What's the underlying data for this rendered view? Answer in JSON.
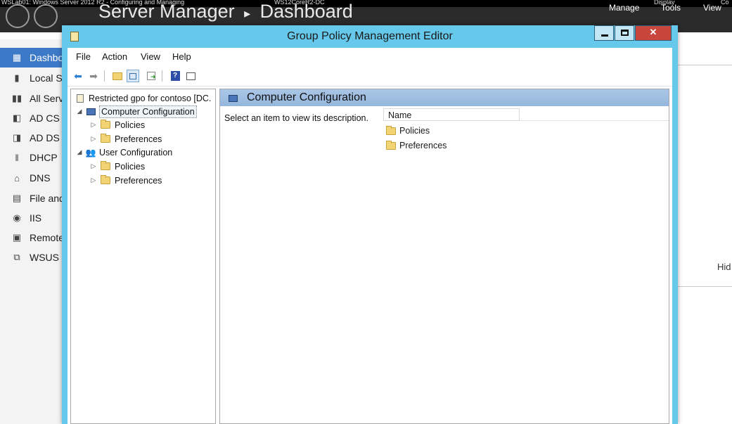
{
  "host_window": {
    "title": "WSLab01: Windows Server 2012 R2 - Configuring and Managing",
    "vm_name": "WS12CoreR2-DC",
    "right_items": [
      "Display",
      "Co"
    ]
  },
  "server_manager": {
    "title": "Server Manager",
    "separator": "▸",
    "page": "Dashboard",
    "menu": [
      "Manage",
      "Tools",
      "View"
    ],
    "nav_items": [
      {
        "label": "Dashboard",
        "icon": "dashboard-icon",
        "active": true
      },
      {
        "label": "Local Server",
        "icon": "server-icon"
      },
      {
        "label": "All Servers",
        "icon": "servers-icon"
      },
      {
        "label": "AD CS",
        "icon": "ad-cs-icon"
      },
      {
        "label": "AD DS",
        "icon": "ad-ds-icon"
      },
      {
        "label": "DHCP",
        "icon": "dhcp-icon"
      },
      {
        "label": "DNS",
        "icon": "dns-icon"
      },
      {
        "label": "File and Storage Services",
        "icon": "file-storage-icon"
      },
      {
        "label": "IIS",
        "icon": "iis-icon"
      },
      {
        "label": "Remote Access",
        "icon": "remote-access-icon"
      },
      {
        "label": "WSUS",
        "icon": "wsus-icon"
      }
    ],
    "right_partial_text": "Hid"
  },
  "gpme": {
    "title": "Group Policy Management Editor",
    "menu": [
      "File",
      "Action",
      "View",
      "Help"
    ],
    "toolbar_icons": [
      "back-arrow-icon",
      "forward-arrow-icon",
      "up-folder-icon",
      "show-hide-tree-icon",
      "export-list-icon",
      "help-icon",
      "properties-icon"
    ],
    "tree": {
      "root": "Restricted gpo for contoso [DC.",
      "computer_config": "Computer Configuration",
      "user_config": "User Configuration",
      "policies": "Policies",
      "preferences": "Preferences"
    },
    "content": {
      "header": "Computer Configuration",
      "description": "Select an item to view its description.",
      "column_name": "Name",
      "items": [
        "Policies",
        "Preferences"
      ]
    },
    "colors": {
      "frame": "#66c8eb",
      "close_button": "#c9463d",
      "content_header": "#aac6e6",
      "nav_active": "#3c79c7"
    }
  }
}
